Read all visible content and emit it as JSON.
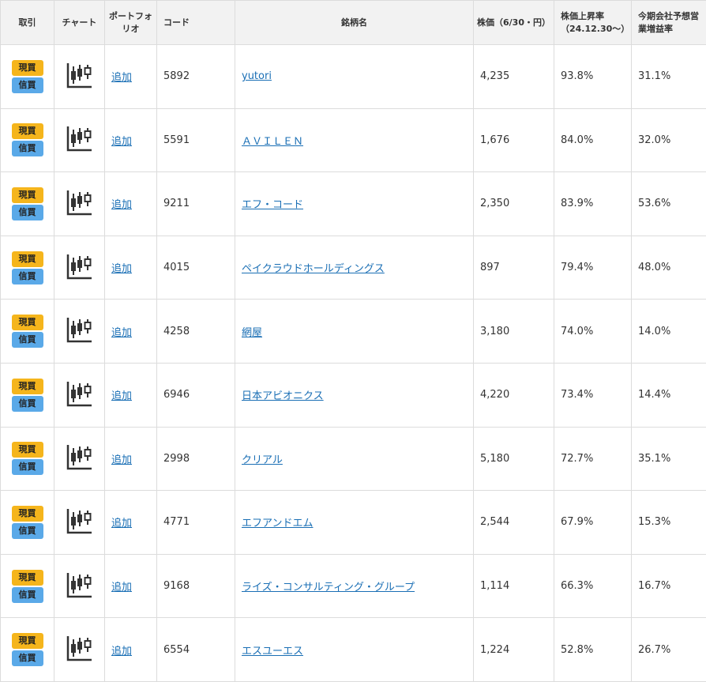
{
  "headers": {
    "trade": "取引",
    "chart": "チャート",
    "portfolio": "ポートフォリオ",
    "code": "コード",
    "name": "銘柄名",
    "price": "株価（6/30・円）",
    "rise_rate": "株価上昇率（24.12.30〜）",
    "forecast": "今期会社予想営業増益率"
  },
  "badges": {
    "cash": "現買",
    "margin": "信買"
  },
  "add_label": "追加",
  "icon_color": "#333333",
  "accent_colors": {
    "cash_badge": "#f5b51c",
    "margin_badge": "#5aa9e8",
    "link": "#1a6fb5"
  },
  "rows": [
    {
      "code": "5892",
      "name": "yutori",
      "price": "4,235",
      "rise": "93.8%",
      "growth": "31.1%"
    },
    {
      "code": "5591",
      "name": "ＡＶＩＬＥＮ",
      "price": "1,676",
      "rise": "84.0%",
      "growth": "32.0%"
    },
    {
      "code": "9211",
      "name": "エフ・コード",
      "price": "2,350",
      "rise": "83.9%",
      "growth": "53.6%"
    },
    {
      "code": "4015",
      "name": "ペイクラウドホールディングス",
      "price": "897",
      "rise": "79.4%",
      "growth": "48.0%"
    },
    {
      "code": "4258",
      "name": "網屋",
      "price": "3,180",
      "rise": "74.0%",
      "growth": "14.0%"
    },
    {
      "code": "6946",
      "name": "日本アビオニクス",
      "price": "4,220",
      "rise": "73.4%",
      "growth": "14.4%"
    },
    {
      "code": "2998",
      "name": "クリアル",
      "price": "5,180",
      "rise": "72.7%",
      "growth": "35.1%"
    },
    {
      "code": "4771",
      "name": "エフアンドエム",
      "price": "2,544",
      "rise": "67.9%",
      "growth": "15.3%"
    },
    {
      "code": "9168",
      "name": "ライズ・コンサルティング・グループ",
      "price": "1,114",
      "rise": "66.3%",
      "growth": "16.7%"
    },
    {
      "code": "6554",
      "name": "エスユーエス",
      "price": "1,224",
      "rise": "52.8%",
      "growth": "26.7%"
    }
  ]
}
